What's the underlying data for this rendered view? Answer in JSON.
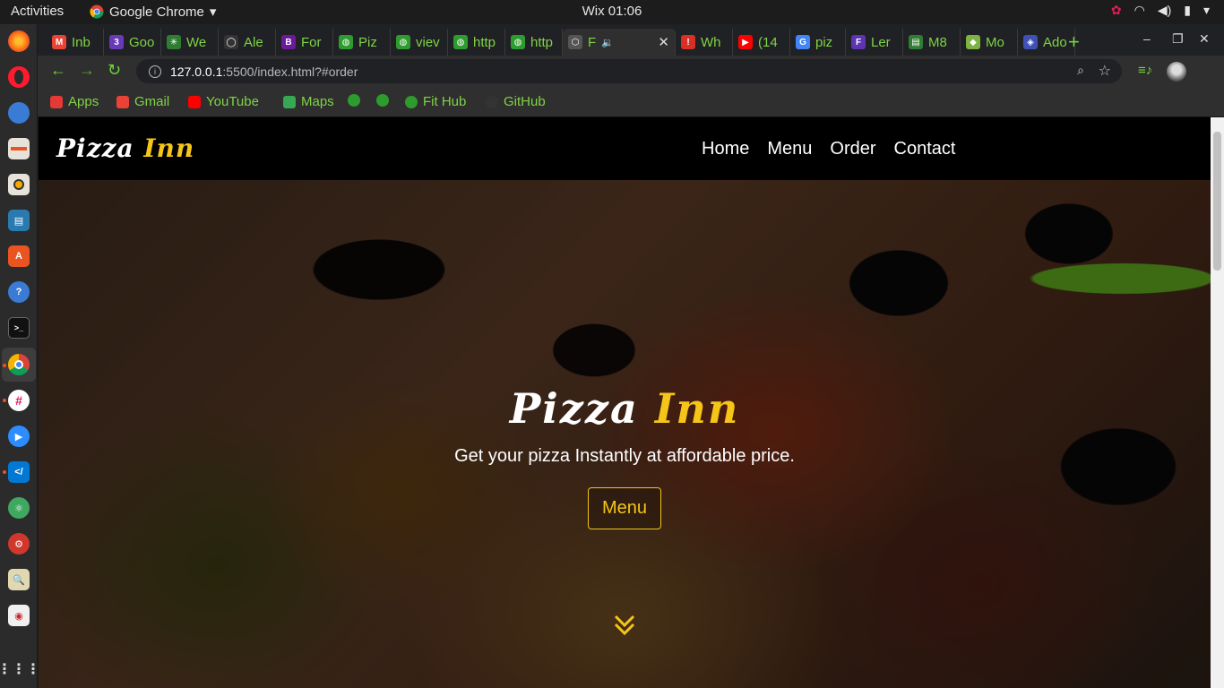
{
  "system": {
    "activities": "Activities",
    "app_name": "Google Chrome",
    "app_menu_arrow": "▾",
    "clock": "Wix 01:06"
  },
  "tabs": [
    {
      "label": "Inb",
      "fav_color": "#ea4335",
      "fav_text": "M"
    },
    {
      "label": "Goo",
      "fav_color": "#673ab7",
      "fav_text": "3"
    },
    {
      "label": "We",
      "fav_color": "#2e7d32",
      "fav_text": "✳"
    },
    {
      "label": "Ale",
      "fav_color": "#333333",
      "fav_text": "◯"
    },
    {
      "label": "For",
      "fav_color": "#6a1b9a",
      "fav_text": "B"
    },
    {
      "label": "Piz",
      "fav_color": "#2e9b2e",
      "fav_text": "◍"
    },
    {
      "label": "viev",
      "fav_color": "#2e9b2e",
      "fav_text": "◍"
    },
    {
      "label": "http",
      "fav_color": "#2e9b2e",
      "fav_text": "◍"
    },
    {
      "label": "http",
      "fav_color": "#2e9b2e",
      "fav_text": "◍"
    },
    {
      "label": "F",
      "fav_color": "#555555",
      "fav_text": "⬡"
    },
    {
      "label": "Wh",
      "fav_color": "#d93025",
      "fav_text": "!"
    },
    {
      "label": "(14",
      "fav_color": "#ff0000",
      "fav_text": "▶"
    },
    {
      "label": "piz",
      "fav_color": "#4285f4",
      "fav_text": "G"
    },
    {
      "label": "Ler",
      "fav_color": "#5e35b1",
      "fav_text": "F"
    },
    {
      "label": "M8",
      "fav_color": "#2e7d32",
      "fav_text": "▤"
    },
    {
      "label": "Mo",
      "fav_color": "#7cb342",
      "fav_text": "◆"
    },
    {
      "label": "Ado",
      "fav_color": "#3f51b5",
      "fav_text": "◈"
    }
  ],
  "window_controls": {
    "minimize": "–",
    "restore": "❐",
    "close": "✕",
    "new_tab": "+"
  },
  "address": {
    "host": "127.0.0.1",
    "rest": ":5500/index.html?#order"
  },
  "bookmarks": [
    {
      "label": "Apps",
      "color": "#e53935"
    },
    {
      "label": "Gmail",
      "color": "#ea4335"
    },
    {
      "label": "YouTube",
      "color": "#ff0000"
    },
    {
      "label": "Maps",
      "color": "#34a853"
    },
    {
      "label": "",
      "color": "#2e9b2e"
    },
    {
      "label": "",
      "color": "#2e9b2e"
    },
    {
      "label": "Fit Hub",
      "color": "#2e9b2e"
    },
    {
      "label": "GitHub",
      "color": "#333333"
    }
  ],
  "site": {
    "logo_main": "Pizza",
    "logo_accent": "Inn",
    "nav": [
      "Home",
      "Menu",
      "Order",
      "Contact"
    ],
    "hero_title_main": "Pizza",
    "hero_title_accent": "Inn",
    "hero_subtitle": "Get your pizza Instantly at affordable price.",
    "hero_button": "Menu",
    "accent_color": "#f5c518"
  }
}
